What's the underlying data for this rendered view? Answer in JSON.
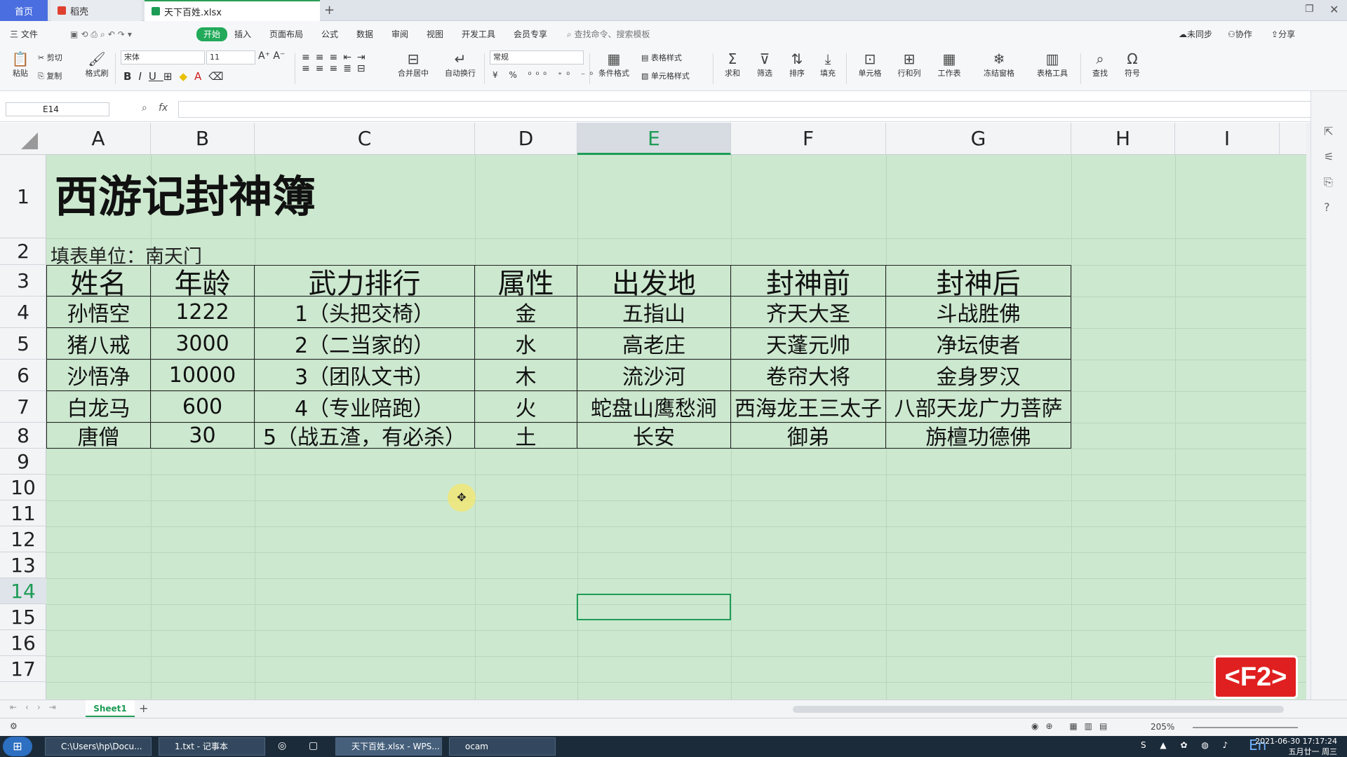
{
  "tabs": {
    "home": "首页",
    "daoke": "稻壳",
    "file": "天下百姓.xlsx"
  },
  "menu": {
    "file": "三 文件",
    "items": [
      "开始",
      "插入",
      "页面布局",
      "公式",
      "数据",
      "审阅",
      "视图",
      "开发工具",
      "会员专享"
    ],
    "search": "查找命令、搜索模板",
    "sync": "未同步",
    "collab": "协作",
    "share": "分享"
  },
  "ribbon": {
    "paste": "粘贴",
    "cut": "剪切",
    "copy": "复制",
    "format_painter": "格式刷",
    "font": "宋体",
    "font_size": "11",
    "merge": "合并居中",
    "wrap": "自动换行",
    "num_format": "常规",
    "cond_format": "条件格式",
    "table_style": "表格样式",
    "cell_style": "单元格样式",
    "sum": "求和",
    "filter": "筛选",
    "sort": "排序",
    "fill": "填充",
    "cell": "单元格",
    "rowcol": "行和列",
    "worksheet": "工作表",
    "freeze": "冻结窗格",
    "table_tool": "表格工具",
    "find": "查找",
    "symbol": "符号"
  },
  "formula": {
    "name_box": "E14",
    "fx": "fx"
  },
  "columns": [
    "A",
    "B",
    "C",
    "D",
    "E",
    "F",
    "G",
    "H",
    "I"
  ],
  "rows": [
    "1",
    "2",
    "3",
    "4",
    "5",
    "6",
    "7",
    "8",
    "9",
    "10",
    "11",
    "12",
    "13",
    "14",
    "15",
    "16",
    "17"
  ],
  "sheet": {
    "title": "西游记封神簿",
    "subtitle": "填表单位：南天门",
    "headers": [
      "姓名",
      "年龄",
      "武力排行",
      "属性",
      "出发地",
      "封神前",
      "封神后"
    ],
    "data": [
      [
        "孙悟空",
        "1222",
        "1（头把交椅）",
        "金",
        "五指山",
        "齐天大圣",
        "斗战胜佛"
      ],
      [
        "猪八戒",
        "3000",
        "2（二当家的）",
        "水",
        "高老庄",
        "天蓬元帅",
        "净坛使者"
      ],
      [
        "沙悟净",
        "10000",
        "3（团队文书）",
        "木",
        "流沙河",
        "卷帘大将",
        "金身罗汉"
      ],
      [
        "白龙马",
        "600",
        "4（专业陪跑）",
        "火",
        "蛇盘山鹰愁涧",
        "西海龙王三太子",
        "八部天龙广力菩萨"
      ],
      [
        "唐僧",
        "30",
        "5（战五渣，有必杀）",
        "土",
        "长安",
        "御弟",
        "旃檀功德佛"
      ]
    ]
  },
  "sheet_tab": "Sheet1",
  "zoom": "205%",
  "badge": "<F2>",
  "taskbar": {
    "items": [
      "C:\\Users\\hp\\Docu...",
      "1.txt - 记事本",
      "天下百姓.xlsx - WPS...",
      "ocam"
    ],
    "time": "2021-06-30 17:17:24",
    "date": "五月廿一 周三",
    "ime": "En"
  },
  "colors": {
    "accent": "#1e9c56",
    "sheet_bg": "#cce8cf",
    "badge": "#e02020"
  }
}
